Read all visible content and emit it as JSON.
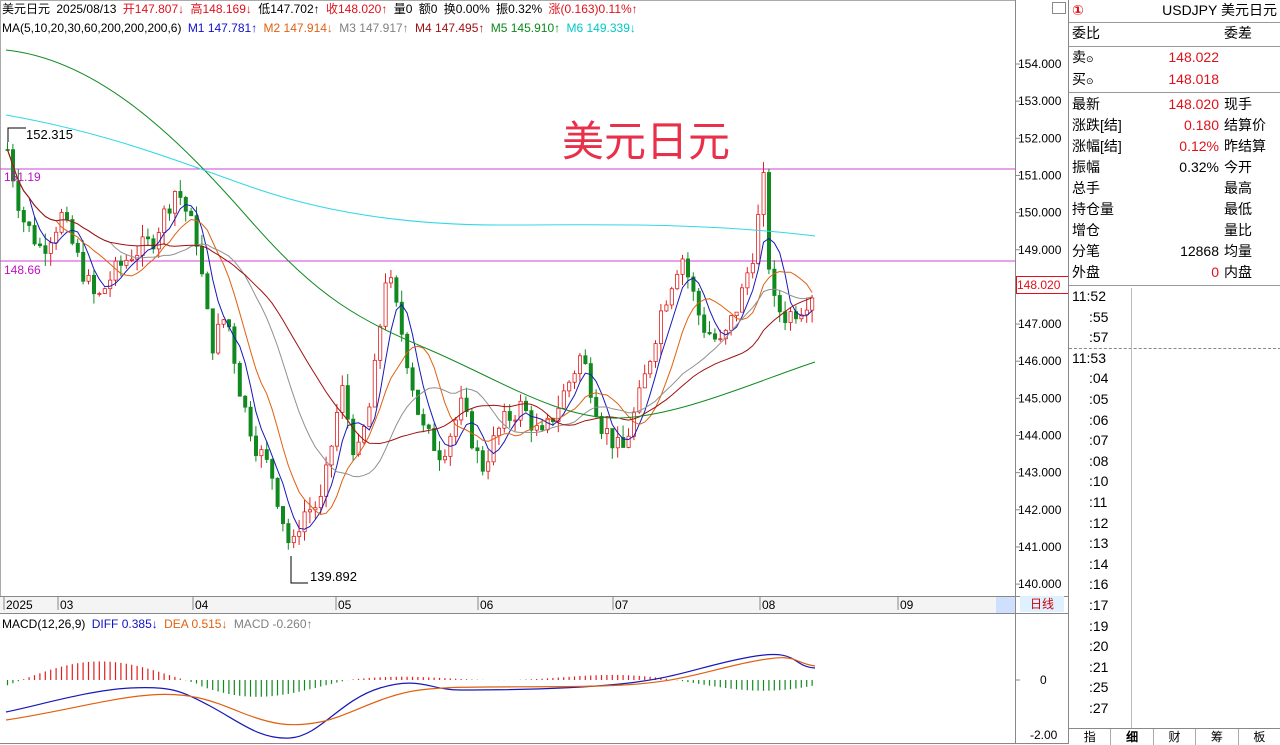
{
  "header": {
    "name": "美元日元",
    "date": "2025/08/13",
    "open": "开147.807↓",
    "high": "高148.169↓",
    "low": "低147.702↑",
    "close": "收148.020↑",
    "volume": "量0",
    "amount": "额0",
    "turnover": "换0.00%",
    "amplitude": "振0.32%",
    "change": "涨(0.163)0.11%↑"
  },
  "ma": {
    "label": "MA(5,10,20,30,60,200,200,200,6)",
    "m1": "M1 147.781↑",
    "m2": "M2 147.914↓",
    "m3": "M3 147.917↑",
    "m4": "M4 147.495↑",
    "m5": "M5 145.910↑",
    "m6": "M6 149.339↓"
  },
  "watermark_title": "美元日元",
  "annotations": {
    "high_label": "152.315",
    "low_label": "139.892",
    "hline1": "151.19",
    "hline2": "148.66",
    "current_price": "148.020"
  },
  "price_axis": [
    "154.000",
    "153.000",
    "152.000",
    "151.000",
    "150.000",
    "149.000",
    "148.000",
    "147.000",
    "146.000",
    "145.000",
    "144.000",
    "143.000",
    "142.000",
    "141.000",
    "140.000"
  ],
  "date_axis": [
    "2025",
    "03",
    "04",
    "05",
    "06",
    "07",
    "08",
    "09"
  ],
  "period_button": "日线",
  "macd": {
    "label": "MACD(12,26,9)",
    "diff": "DIFF 0.385↓",
    "dea": "DEA 0.515↓",
    "macd": "MACD -0.260↑",
    "axis_zero": "0",
    "axis_low": "-2.00"
  },
  "panel": {
    "badge": "①",
    "symbol": "USDJPY 美元日元",
    "weibi": "委比",
    "weicha": "委差",
    "sell_label": "卖",
    "sell_value": "148.022",
    "buy_label": "买",
    "buy_value": "148.018",
    "rows": [
      {
        "l": "最新",
        "v": "148.020",
        "r": "现手",
        "color": "red"
      },
      {
        "l": "涨跌[结]",
        "v": "0.180",
        "r": "结算价",
        "color": "red"
      },
      {
        "l": "涨幅[结]",
        "v": "0.12%",
        "r": "昨结算",
        "color": "red"
      },
      {
        "l": "振幅",
        "v": "0.32%",
        "r": "今开",
        "color": "black"
      },
      {
        "l": "总手",
        "v": "",
        "r": "最高",
        "color": "black"
      },
      {
        "l": "持仓量",
        "v": "",
        "r": "最低",
        "color": "black"
      },
      {
        "l": "增仓",
        "v": "",
        "r": "量比",
        "color": "black"
      },
      {
        "l": "分笔",
        "v": "12868",
        "r": "均量",
        "color": "black"
      },
      {
        "l": "外盘",
        "v": "0",
        "r": "内盘",
        "color": "red"
      }
    ],
    "times": [
      "11:52",
      ":55",
      ":57",
      "11:53",
      ":04",
      ":05",
      ":06",
      ":07",
      ":08",
      ":10",
      ":11",
      ":12",
      ":13",
      ":14",
      ":16",
      ":17",
      ":19",
      ":20",
      ":21",
      ":25",
      ":27"
    ],
    "tabs": [
      "指",
      "细",
      "财",
      "筹",
      "板"
    ]
  }
}
